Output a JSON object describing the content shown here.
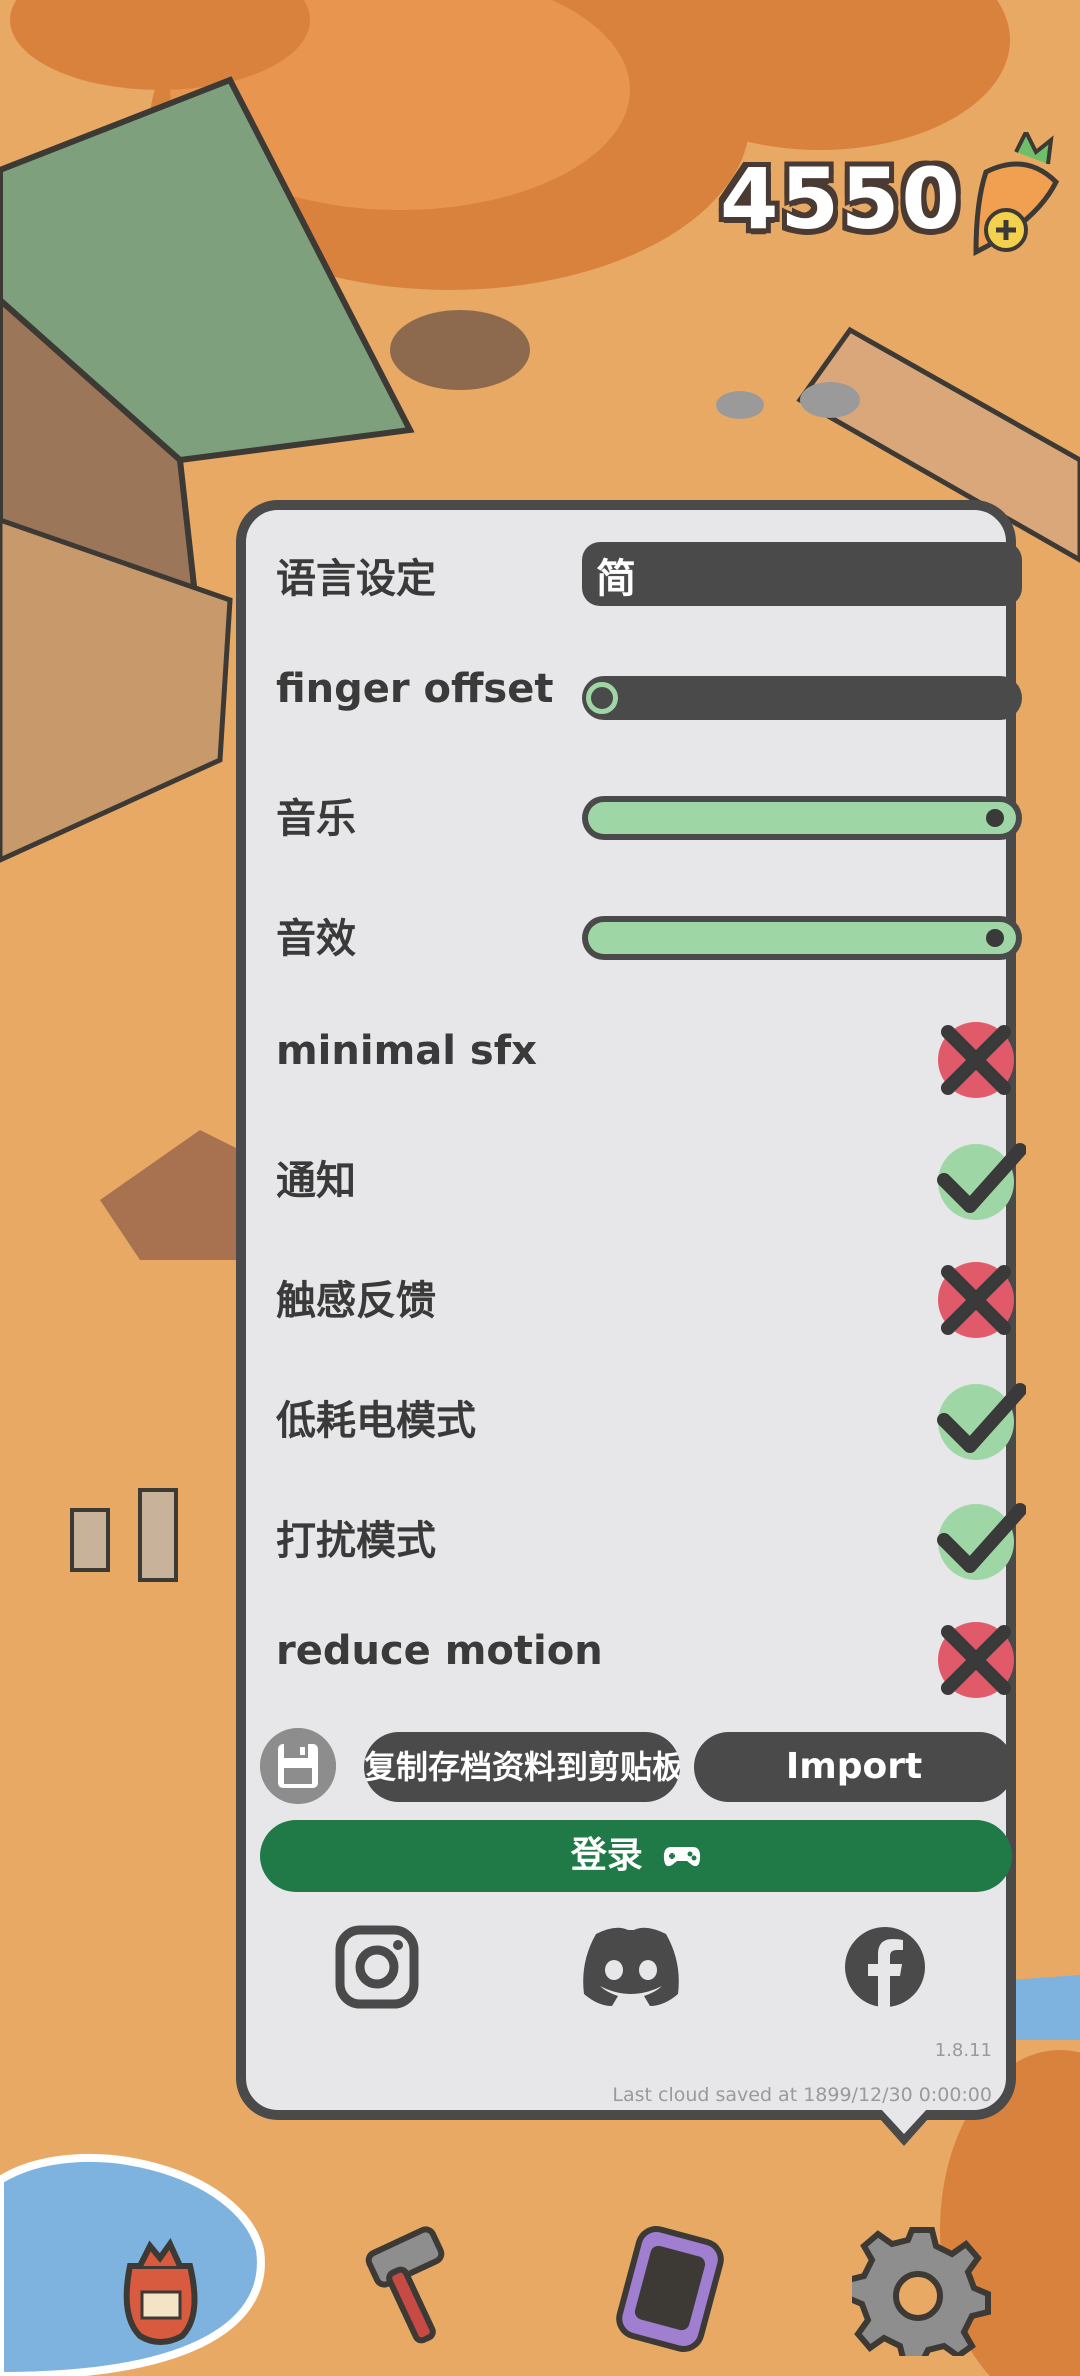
{
  "hud": {
    "carrot_count": "4550"
  },
  "settings": {
    "language": {
      "label": "语言设定",
      "value": "简"
    },
    "finger_offset": {
      "label": "finger offset",
      "level": 0.0
    },
    "music": {
      "label": "音乐",
      "level": 1.0
    },
    "sfx": {
      "label": "音效",
      "level": 1.0
    },
    "toggles": [
      {
        "label": "minimal sfx",
        "on": false
      },
      {
        "label": "通知",
        "on": true
      },
      {
        "label": "触感反馈",
        "on": false
      },
      {
        "label": "低耗电模式",
        "on": true
      },
      {
        "label": "打扰模式",
        "on": true
      },
      {
        "label": "reduce motion",
        "on": false
      }
    ]
  },
  "actions": {
    "copy_label": "复制存档资料到剪贴板",
    "import_label": "Import",
    "login_label": "登录"
  },
  "footer": {
    "version": "1.8.11",
    "cloud_saved": "Last cloud saved at 1899/12/30 0:00:00"
  },
  "colors": {
    "panel_bg": "#e7e7e9",
    "dark": "#4a4a4a",
    "green_fill": "#9fd6a6",
    "login_green": "#1f7a47",
    "check_green": "#9fd6a6",
    "cross_red": "#e05a6a"
  },
  "icons": {
    "social": [
      "instagram-icon",
      "discord-icon",
      "facebook-icon"
    ],
    "nav": [
      "bag-icon",
      "hammer-icon",
      "phone-icon",
      "gear-icon"
    ]
  }
}
